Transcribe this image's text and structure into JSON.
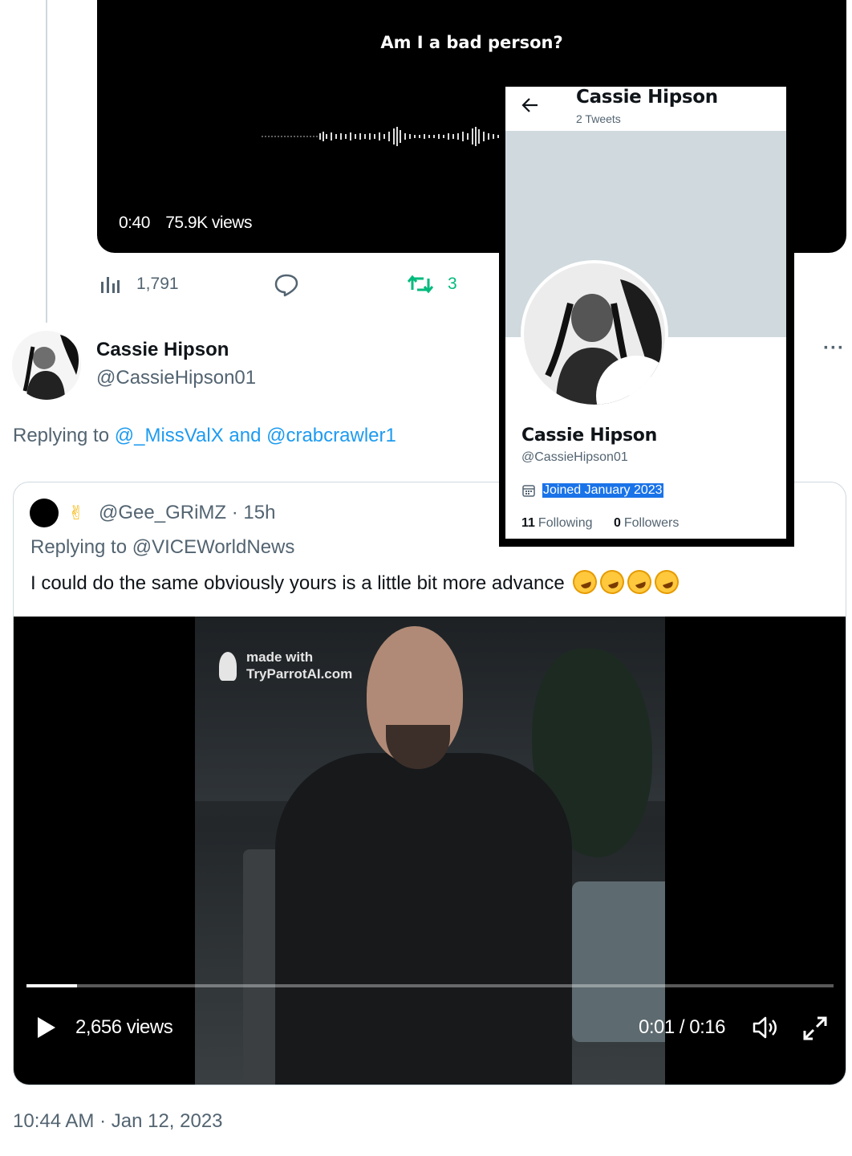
{
  "top_video": {
    "caption": "Am I a bad person?",
    "duration": "0:40",
    "views": "75.9K views"
  },
  "actions": {
    "views_count": "1,791",
    "retweets_count": "3",
    "retweet_color": "#00ba7c"
  },
  "tweet": {
    "author_name": "Cassie Hipson",
    "author_handle": "@CassieHipson01",
    "replying_prefix": "Replying to",
    "replying_link_1": "@_MissValX",
    "replying_and": "and",
    "replying_link_2": "@crabcrawler1",
    "timestamp": "10:44 AM · Jan 12, 2023"
  },
  "quote": {
    "emoji": "✌",
    "header": "@Gee_GRiMZ · 15h",
    "replying": "Replying to @VICEWorldNews",
    "text": "I could do the same obviously yours is a little bit more advance",
    "emoji_names": [
      "rolling-on-floor-laughing",
      "rolling-on-floor-laughing",
      "rolling-on-floor-laughing",
      "rolling-on-floor-laughing"
    ],
    "video": {
      "watermark_line1": "made with",
      "watermark_line2": "TryParrotAI.com",
      "views": "2,656 views",
      "time": "0:01 / 0:16",
      "progress": 0.0625
    }
  },
  "profile": {
    "title": "Cassie Hipson",
    "tweet_count": "2 Tweets",
    "name": "Cassie Hipson",
    "handle": "@CassieHipson01",
    "joined": "Joined January 2023",
    "following_count": "11",
    "following_label": "Following",
    "followers_count": "0",
    "followers_label": "Followers",
    "banner_color": "#cfd9de"
  },
  "colors": {
    "link": "#1d9bf0",
    "secondary_text": "#536471",
    "border": "#cfd9de"
  }
}
